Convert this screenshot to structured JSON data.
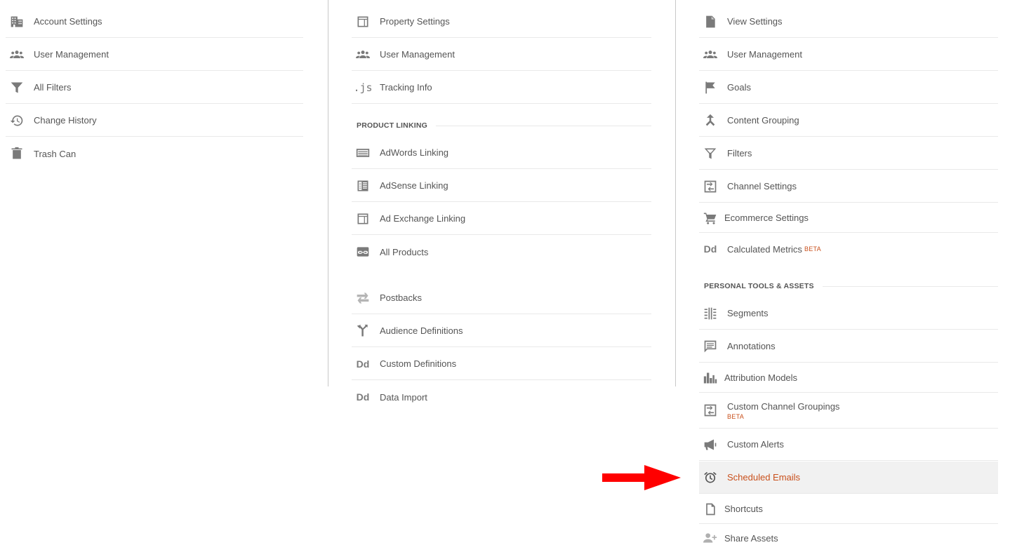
{
  "account_column": {
    "items": [
      {
        "label": "Account Settings",
        "icon": "building-icon"
      },
      {
        "label": "User Management",
        "icon": "people-icon"
      },
      {
        "label": "All Filters",
        "icon": "funnel-icon"
      },
      {
        "label": "Change History",
        "icon": "history-icon"
      },
      {
        "label": "Trash Can",
        "icon": "trash-icon"
      }
    ]
  },
  "property_column": {
    "items": [
      {
        "label": "Property Settings",
        "icon": "window-icon"
      },
      {
        "label": "User Management",
        "icon": "people-icon"
      },
      {
        "label": "Tracking Info",
        "icon": "js-icon",
        "icon_text": ".js"
      }
    ],
    "product_linking": {
      "title": "PRODUCT LINKING",
      "items": [
        {
          "label": "AdWords Linking",
          "icon": "adwords-icon"
        },
        {
          "label": "AdSense Linking",
          "icon": "adsense-icon"
        },
        {
          "label": "Ad Exchange Linking",
          "icon": "window-icon"
        },
        {
          "label": "All Products",
          "icon": "link-icon"
        }
      ]
    },
    "other_items": [
      {
        "label": "Postbacks",
        "icon": "postback-icon"
      },
      {
        "label": "Audience Definitions",
        "icon": "audience-fork-icon"
      },
      {
        "label": "Custom Definitions",
        "icon": "dd-icon",
        "icon_text": "Dd"
      },
      {
        "label": "Data Import",
        "icon": "dd-icon",
        "icon_text": "Dd"
      }
    ]
  },
  "view_column": {
    "items": [
      {
        "label": "View Settings",
        "icon": "document-icon"
      },
      {
        "label": "User Management",
        "icon": "people-icon"
      },
      {
        "label": "Goals",
        "icon": "flag-icon"
      },
      {
        "label": "Content Grouping",
        "icon": "merge-icon"
      },
      {
        "label": "Filters",
        "icon": "funnel-icon"
      },
      {
        "label": "Channel Settings",
        "icon": "channel-icon"
      },
      {
        "label": "Ecommerce Settings",
        "icon": "cart-icon"
      },
      {
        "label": "Calculated Metrics",
        "icon": "dd-icon",
        "icon_text": "Dd",
        "badge": "BETA"
      }
    ],
    "personal_tools": {
      "title": "PERSONAL TOOLS & ASSETS",
      "items": [
        {
          "label": "Segments",
          "icon": "segments-icon"
        },
        {
          "label": "Annotations",
          "icon": "annotation-icon"
        },
        {
          "label": "Attribution Models",
          "icon": "bar-chart-icon"
        },
        {
          "label": "Custom Channel Groupings",
          "icon": "channel-icon",
          "badge": "BETA"
        },
        {
          "label": "Custom Alerts",
          "icon": "megaphone-icon"
        },
        {
          "label": "Scheduled Emails",
          "icon": "alarm-clock-icon",
          "selected": true
        },
        {
          "label": "Shortcuts",
          "icon": "page-icon"
        },
        {
          "label": "Share Assets",
          "icon": "add-person-icon"
        }
      ]
    }
  },
  "colors": {
    "accent": "#c9501c",
    "icon": "#7a7a7a",
    "text": "#555555",
    "divider": "#e9e9e9",
    "selected_bg": "#f1f1f1",
    "arrow": "#ff0000"
  }
}
